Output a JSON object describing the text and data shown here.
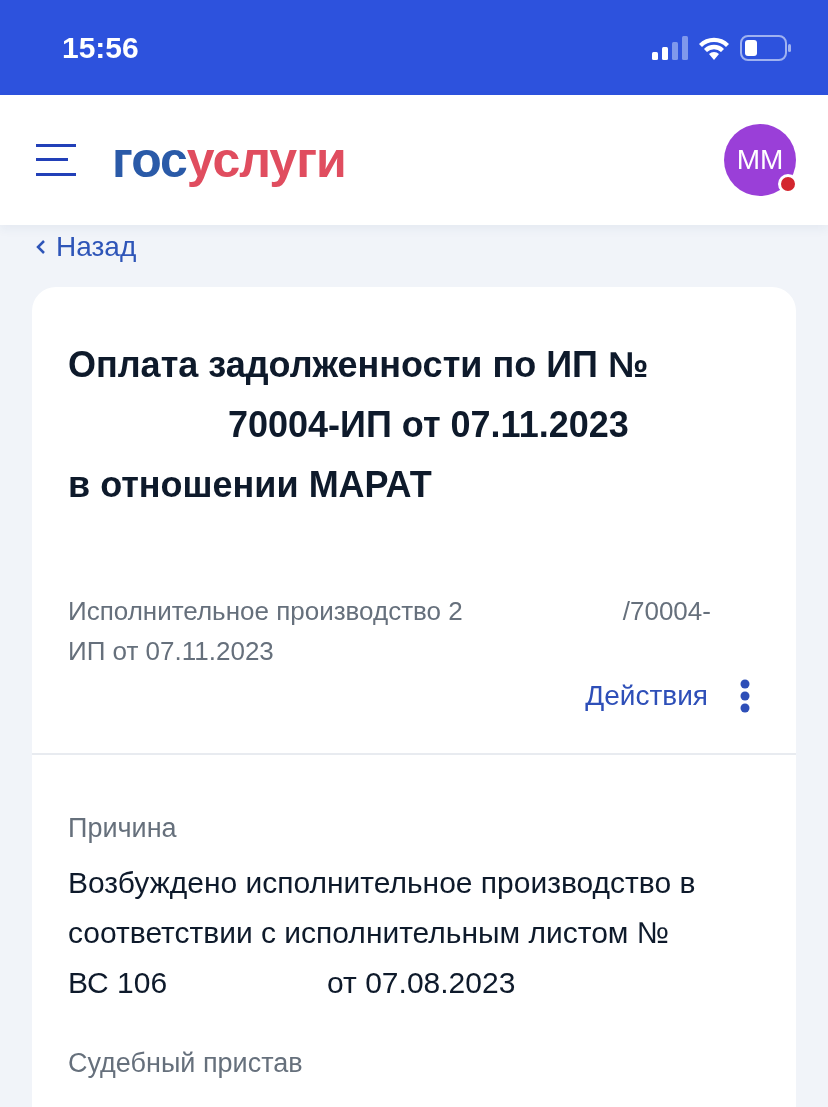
{
  "status_bar": {
    "time": "15:56"
  },
  "header": {
    "logo_parts": [
      {
        "text": "гос",
        "kind": "primary"
      },
      {
        "text": "услуги",
        "kind": "accent"
      }
    ],
    "avatar": {
      "initials": "ММ",
      "notification": true
    }
  },
  "back_link": {
    "label": "Назад"
  },
  "card": {
    "title_lines": [
      [
        {
          "kind": "text",
          "text": "Оплата задолженности по ИП №"
        }
      ],
      [
        {
          "kind": "redacted"
        },
        {
          "kind": "text",
          "text": "70004-ИП от 07.11.2023"
        }
      ],
      [
        {
          "kind": "text",
          "text": "в отношении МАРАТ"
        }
      ]
    ],
    "subtitle_lines": [
      [
        {
          "kind": "text",
          "text": "Исполнительное производство 2"
        },
        {
          "kind": "redacted"
        },
        {
          "kind": "text",
          "text": "/70004-"
        }
      ],
      [
        {
          "kind": "text",
          "text": "ИП от 07.11.2023"
        }
      ]
    ],
    "actions_label": "Действия",
    "sections": [
      {
        "label": "Причина",
        "lines": [
          [
            {
              "kind": "text",
              "text": "Возбуждено исполнительное производство в"
            }
          ],
          [
            {
              "kind": "text",
              "text": "соответствии с исполнительным листом №"
            }
          ],
          [
            {
              "kind": "text",
              "text": "ВС 106"
            },
            {
              "kind": "redacted"
            },
            {
              "kind": "text",
              "text": "от 07.08.2023"
            }
          ]
        ]
      },
      {
        "label": "Судебный пристав"
      }
    ]
  }
}
